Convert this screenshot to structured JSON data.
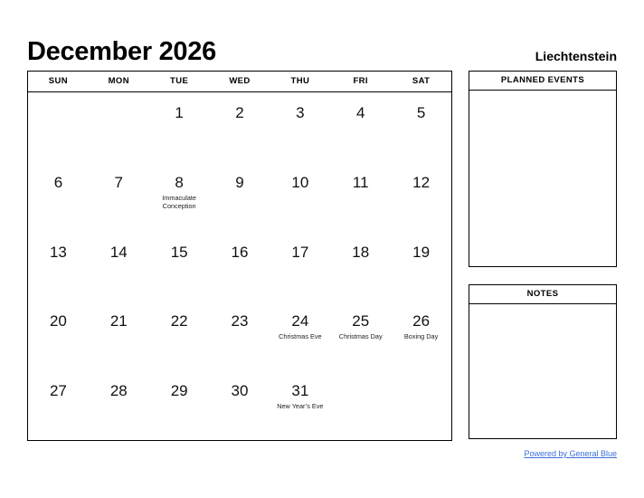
{
  "header": {
    "title": "December 2026",
    "country": "Liechtenstein"
  },
  "calendar": {
    "weekdays": [
      "SUN",
      "MON",
      "TUE",
      "WED",
      "THU",
      "FRI",
      "SAT"
    ],
    "weeks": [
      [
        {
          "day": "",
          "event": ""
        },
        {
          "day": "",
          "event": ""
        },
        {
          "day": "1",
          "event": ""
        },
        {
          "day": "2",
          "event": ""
        },
        {
          "day": "3",
          "event": ""
        },
        {
          "day": "4",
          "event": ""
        },
        {
          "day": "5",
          "event": ""
        }
      ],
      [
        {
          "day": "6",
          "event": ""
        },
        {
          "day": "7",
          "event": ""
        },
        {
          "day": "8",
          "event": "Immaculate Conception"
        },
        {
          "day": "9",
          "event": ""
        },
        {
          "day": "10",
          "event": ""
        },
        {
          "day": "11",
          "event": ""
        },
        {
          "day": "12",
          "event": ""
        }
      ],
      [
        {
          "day": "13",
          "event": ""
        },
        {
          "day": "14",
          "event": ""
        },
        {
          "day": "15",
          "event": ""
        },
        {
          "day": "16",
          "event": ""
        },
        {
          "day": "17",
          "event": ""
        },
        {
          "day": "18",
          "event": ""
        },
        {
          "day": "19",
          "event": ""
        }
      ],
      [
        {
          "day": "20",
          "event": ""
        },
        {
          "day": "21",
          "event": ""
        },
        {
          "day": "22",
          "event": ""
        },
        {
          "day": "23",
          "event": ""
        },
        {
          "day": "24",
          "event": "Christmas Eve"
        },
        {
          "day": "25",
          "event": "Christmas Day"
        },
        {
          "day": "26",
          "event": "Boxing Day"
        }
      ],
      [
        {
          "day": "27",
          "event": ""
        },
        {
          "day": "28",
          "event": ""
        },
        {
          "day": "29",
          "event": ""
        },
        {
          "day": "30",
          "event": ""
        },
        {
          "day": "31",
          "event": "New Year’s Eve"
        },
        {
          "day": "",
          "event": ""
        },
        {
          "day": "",
          "event": ""
        }
      ]
    ]
  },
  "panels": {
    "planned_events": {
      "header": "PLANNED EVENTS",
      "content": ""
    },
    "notes": {
      "header": "NOTES",
      "content": ""
    }
  },
  "footer": {
    "link_label": "Powered by General Blue",
    "link_color": "#3a6fd8"
  }
}
